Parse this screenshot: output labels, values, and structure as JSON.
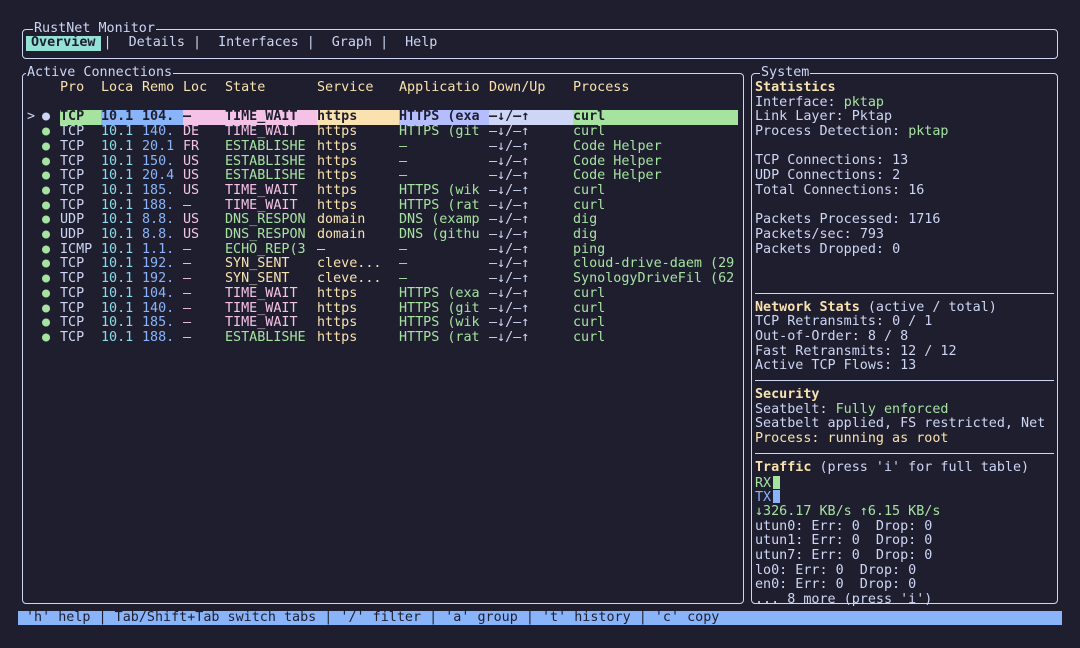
{
  "app": {
    "title": "RustNet Monitor",
    "tabs": [
      "Overview",
      "Details",
      "Interfaces",
      "Graph",
      "Help"
    ],
    "active_tab": 0
  },
  "connections": {
    "title": "Active Connections",
    "columns": [
      "Pro",
      "Loca",
      "Remo",
      "Loc",
      "State",
      "Service",
      "Applicatio",
      "Down/Up",
      "Process"
    ],
    "selected_marker": ">",
    "rows": [
      {
        "dot": "●",
        "proto": "TCP",
        "local": "10.1",
        "remote": "104.",
        "loc": "–",
        "state": "TIME_WAIT",
        "service": "https",
        "app": "HTTPS (exa",
        "bw": "–↓/–↑",
        "process": "curl"
      },
      {
        "dot": "●",
        "proto": "TCP",
        "local": "10.1",
        "remote": "140.",
        "loc": "DE",
        "state": "TIME_WAIT",
        "service": "https",
        "app": "HTTPS (git",
        "bw": "–↓/–↑",
        "process": "curl"
      },
      {
        "dot": "●",
        "proto": "TCP",
        "local": "10.1",
        "remote": "20.1",
        "loc": "FR",
        "state": "ESTABLISHE",
        "service": "https",
        "app": "–",
        "bw": "–↓/–↑",
        "process": "Code Helper"
      },
      {
        "dot": "●",
        "proto": "TCP",
        "local": "10.1",
        "remote": "150.",
        "loc": "US",
        "state": "ESTABLISHE",
        "service": "https",
        "app": "–",
        "bw": "–↓/–↑",
        "process": "Code Helper"
      },
      {
        "dot": "●",
        "proto": "TCP",
        "local": "10.1",
        "remote": "20.4",
        "loc": "US",
        "state": "ESTABLISHE",
        "service": "https",
        "app": "–",
        "bw": "–↓/–↑",
        "process": "Code Helper"
      },
      {
        "dot": "●",
        "proto": "TCP",
        "local": "10.1",
        "remote": "185.",
        "loc": "US",
        "state": "TIME_WAIT",
        "service": "https",
        "app": "HTTPS (wik",
        "bw": "–↓/–↑",
        "process": "curl"
      },
      {
        "dot": "●",
        "proto": "TCP",
        "local": "10.1",
        "remote": "188.",
        "loc": "–",
        "state": "TIME_WAIT",
        "service": "https",
        "app": "HTTPS (rat",
        "bw": "–↓/–↑",
        "process": "curl"
      },
      {
        "dot": "●",
        "proto": "UDP",
        "local": "10.1",
        "remote": "8.8.",
        "loc": "US",
        "state": "DNS_RESPON",
        "service": "domain",
        "app": "DNS (examp",
        "bw": "–↓/–↑",
        "process": "dig"
      },
      {
        "dot": "●",
        "proto": "UDP",
        "local": "10.1",
        "remote": "8.8.",
        "loc": "US",
        "state": "DNS_RESPON",
        "service": "domain",
        "app": "DNS (githu",
        "bw": "–↓/–↑",
        "process": "dig"
      },
      {
        "dot": "●",
        "proto": "ICMP",
        "local": "10.1",
        "remote": "1.1.",
        "loc": "–",
        "state": "ECHO_REP(3",
        "service": "–",
        "app": "–",
        "bw": "–↓/–↑",
        "process": "ping"
      },
      {
        "dot": "●",
        "proto": "TCP",
        "local": "10.1",
        "remote": "192.",
        "loc": "–",
        "state": "SYN_SENT",
        "service": "cleve...",
        "app": "–",
        "bw": "–↓/–↑",
        "process": "cloud-drive-daem (29"
      },
      {
        "dot": "●",
        "proto": "TCP",
        "local": "10.1",
        "remote": "192.",
        "loc": "–",
        "state": "SYN_SENT",
        "service": "cleve...",
        "app": "–",
        "bw": "–↓/–↑",
        "process": "SynologyDriveFil (62"
      },
      {
        "dot": "●",
        "proto": "TCP",
        "local": "10.1",
        "remote": "104.",
        "loc": "–",
        "state": "TIME_WAIT",
        "service": "https",
        "app": "HTTPS (exa",
        "bw": "–↓/–↑",
        "process": "curl"
      },
      {
        "dot": "●",
        "proto": "TCP",
        "local": "10.1",
        "remote": "140.",
        "loc": "–",
        "state": "TIME_WAIT",
        "service": "https",
        "app": "HTTPS (git",
        "bw": "–↓/–↑",
        "process": "curl"
      },
      {
        "dot": "●",
        "proto": "TCP",
        "local": "10.1",
        "remote": "185.",
        "loc": "–",
        "state": "TIME_WAIT",
        "service": "https",
        "app": "HTTPS (wik",
        "bw": "–↓/–↑",
        "process": "curl"
      },
      {
        "dot": "●",
        "proto": "TCP",
        "local": "10.1",
        "remote": "188.",
        "loc": "–",
        "state": "ESTABLISHE",
        "service": "https",
        "app": "HTTPS (rat",
        "bw": "–↓/–↑",
        "process": "curl"
      }
    ]
  },
  "system": {
    "title": "System",
    "statistics": {
      "heading": "Statistics",
      "interface_label": "Interface:",
      "interface": "pktap",
      "link_layer_label": "Link Layer:",
      "link_layer": "Pktap",
      "process_detection_label": "Process Detection:",
      "process_detection": "pktap",
      "tcp_label": "TCP Connections:",
      "tcp": "13",
      "udp_label": "UDP Connections:",
      "udp": "2",
      "total_label": "Total Connections:",
      "total": "16",
      "processed_label": "Packets Processed:",
      "processed": "1716",
      "pps_label": "Packets/sec:",
      "pps": "793",
      "dropped_label": "Packets Dropped:",
      "dropped": "0"
    },
    "network": {
      "heading": "Network Stats",
      "heading_note": "(active / total)",
      "retrans_label": "TCP Retransmits:",
      "retrans": "0 / 1",
      "ooo_label": "Out-of-Order:",
      "ooo": "8 / 8",
      "fast_label": "Fast Retransmits:",
      "fast": "12 / 12",
      "flows_label": "Active TCP Flows:",
      "flows": "13"
    },
    "security": {
      "heading": "Security",
      "seatbelt_label": "Seatbelt:",
      "seatbelt": "Fully enforced",
      "detail": "Seatbelt applied, FS restricted, Net",
      "process": "Process: running as root"
    },
    "traffic": {
      "heading": "Traffic",
      "heading_note": "(press 'i' for full table)",
      "rx_label": "RX",
      "tx_label": "TX",
      "rates": "↓326.17 KB/s ↑6.15 KB/s",
      "interfaces": [
        "utun0: Err: 0  Drop: 0",
        "utun1: Err: 0  Drop: 0",
        "utun7: Err: 0  Drop: 0",
        "lo0: Err: 0  Drop: 0",
        "en0: Err: 0  Drop: 0"
      ],
      "more": "... 8 more (press 'i')"
    }
  },
  "status_bar": "'h' help | Tab/Shift+Tab switch tabs | '/' filter | 'a' group | 't' history | 'c' copy",
  "colors": {
    "background": "#1e1e2e",
    "text": "#cdd6f4",
    "header": "#f9e2af",
    "active_tab": "#94e2d5",
    "green": "#a6e3a1",
    "blue": "#89b4fa",
    "pink": "#f5c2e7",
    "peach": "#fab387",
    "status_bar": "#89b4fa"
  }
}
